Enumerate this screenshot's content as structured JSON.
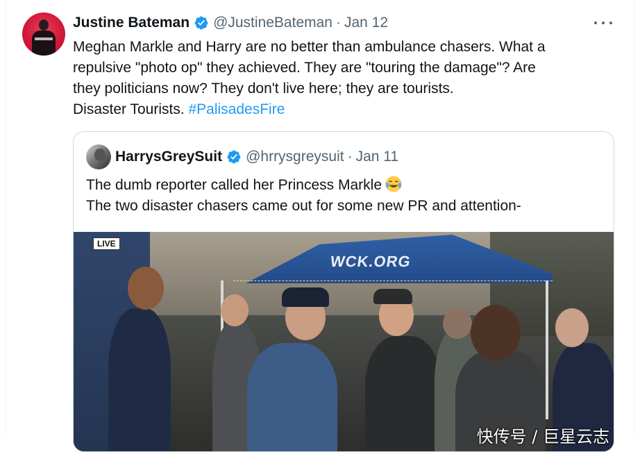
{
  "tweet": {
    "author_name": "Justine Bateman",
    "handle": "@JustineBateman",
    "separator": "·",
    "date": "Jan 12",
    "text_lines": [
      "Meghan Markle and Harry are no better than ambulance chasers. What a",
      "repulsive \"photo op\" they achieved. They are \"touring the damage\"? Are",
      "they politicians now? They don't live here; they are tourists."
    ],
    "last_line_prefix": "Disaster Tourists. ",
    "hashtag": "#PalisadesFire"
  },
  "quote": {
    "author_name": "HarrysGreySuit",
    "handle": "@hrrysgreysuit",
    "separator": "·",
    "date": "Jan 11",
    "line1": "The dumb reporter called her Princess Markle",
    "line2": "The two disaster chasers came out for some new PR and attention-",
    "emoji_icon": "face-with-tears-of-joy-icon"
  },
  "video": {
    "live_label": "LIVE",
    "tent_text": "WCK.ORG",
    "watermark": "快传号 / 巨星云志"
  },
  "colors": {
    "link": "#1d9bf0",
    "verified": "#1d9bf0",
    "secondary_text": "#536471",
    "border": "#cfd9de"
  }
}
